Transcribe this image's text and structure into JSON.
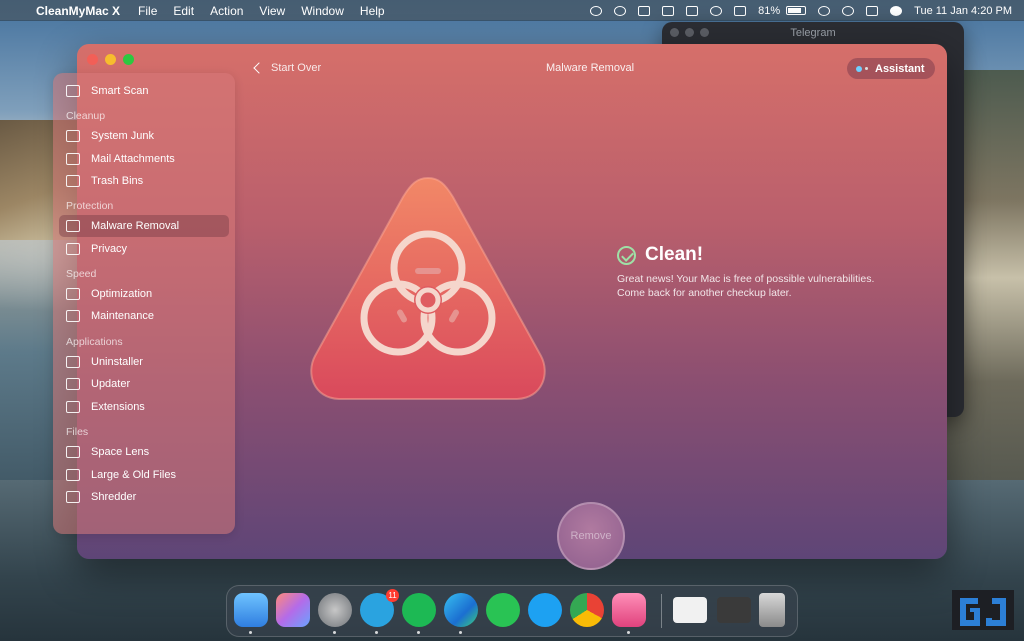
{
  "menubar": {
    "app_name": "CleanMyMac X",
    "menus": [
      "File",
      "Edit",
      "Action",
      "View",
      "Window",
      "Help"
    ],
    "battery": "81%",
    "clock": "Tue 11 Jan  4:20 PM"
  },
  "background_window": {
    "title": "Telegram"
  },
  "window": {
    "back_label": "Start Over",
    "title": "Malware Removal",
    "assistant_label": "Assistant"
  },
  "sidebar": {
    "top_item": {
      "label": "Smart Scan",
      "icon": "monitor-icon"
    },
    "sections": [
      {
        "label": "Cleanup",
        "items": [
          {
            "label": "System Junk",
            "icon": "hard-drive-icon"
          },
          {
            "label": "Mail Attachments",
            "icon": "envelope-icon"
          },
          {
            "label": "Trash Bins",
            "icon": "trash-icon"
          }
        ]
      },
      {
        "label": "Protection",
        "items": [
          {
            "label": "Malware Removal",
            "icon": "biohazard-icon",
            "active": true
          },
          {
            "label": "Privacy",
            "icon": "hand-icon"
          }
        ]
      },
      {
        "label": "Speed",
        "items": [
          {
            "label": "Optimization",
            "icon": "sliders-icon"
          },
          {
            "label": "Maintenance",
            "icon": "wrench-icon"
          }
        ]
      },
      {
        "label": "Applications",
        "items": [
          {
            "label": "Uninstaller",
            "icon": "uninstall-icon"
          },
          {
            "label": "Updater",
            "icon": "refresh-icon"
          },
          {
            "label": "Extensions",
            "icon": "extensions-icon"
          }
        ]
      },
      {
        "label": "Files",
        "items": [
          {
            "label": "Space Lens",
            "icon": "lens-icon"
          },
          {
            "label": "Large & Old Files",
            "icon": "folder-icon"
          },
          {
            "label": "Shredder",
            "icon": "shredder-icon"
          }
        ]
      }
    ]
  },
  "result": {
    "title": "Clean!",
    "message_line1": "Great news! Your Mac is free of possible vulnerabilities.",
    "message_line2": "Come back for another checkup later."
  },
  "action_button": {
    "label": "Remove"
  },
  "dock": {
    "apps": [
      "finder",
      "launchpad",
      "system-preferences",
      "telegram",
      "spotify",
      "edge",
      "whatsapp",
      "twitter",
      "chrome-like",
      "cleanmymac"
    ],
    "telegram_badge": "11"
  },
  "colors": {
    "accent_gradient_top": "#d66f6a",
    "accent_gradient_bottom": "#5e4577",
    "check_green": "#9fe0a6",
    "assistant_dot": "#6fd0ff"
  }
}
